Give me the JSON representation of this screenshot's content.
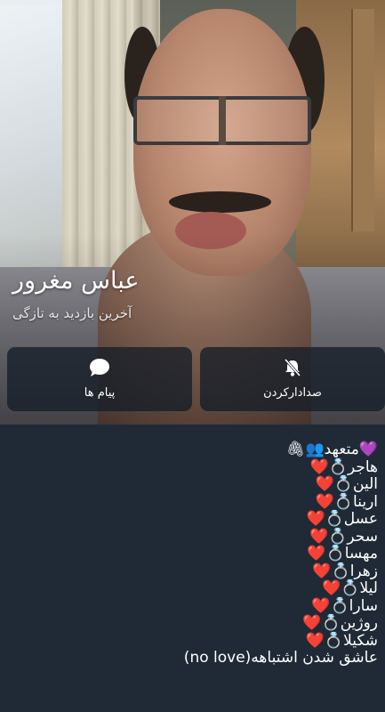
{
  "profile": {
    "name": "عباس مغرور",
    "last_seen": "آخرین بازدید به تازگی"
  },
  "actions": {
    "messages_label": "پیام ها",
    "unmute_label": "صدادارکردن"
  },
  "bio": {
    "lines": [
      "💜متعهد👥🖇",
      "هاجر💍❤️",
      "الین💍❤️",
      "ارینا💍❤️",
      "عسل💍❤️",
      "سحر💍❤️",
      "مهسا💍❤️",
      "زهرا💍❤️",
      "لیلا💍❤️",
      "سارا💍❤️",
      "روژین💍❤️",
      "شکیلا💍❤️",
      "عاشق شدن اشتباهه(no love)"
    ]
  },
  "colors": {
    "background": "#1f2a36",
    "button_bg": "#161e28"
  },
  "icons": {
    "messages": "chat-bubble-icon",
    "unmute": "bell-off-icon"
  }
}
